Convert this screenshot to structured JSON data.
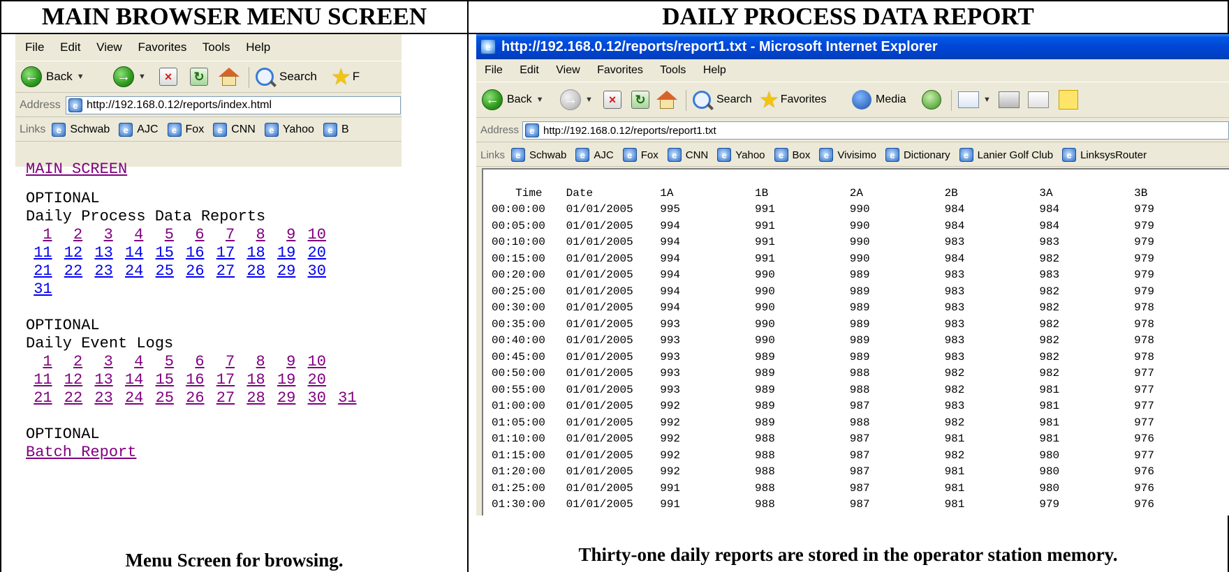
{
  "left_panel": {
    "title": "MAIN BROWSER MENU SCREEN",
    "caption": "Menu Screen for browsing.",
    "browser": {
      "menu": [
        "File",
        "Edit",
        "View",
        "Favorites",
        "Tools",
        "Help"
      ],
      "toolbar": {
        "back": "Back",
        "search": "Search",
        "favorites_partial": "F"
      },
      "address_label": "Address",
      "address": "http://192.168.0.12/reports/index.html",
      "links_label": "Links",
      "links": [
        "Schwab",
        "AJC",
        "Fox",
        "CNN",
        "Yahoo",
        "B"
      ]
    },
    "page": {
      "main_screen_link": "MAIN SCREEN",
      "section1_heading": "OPTIONAL",
      "section1_title": "Daily Process Data Reports",
      "section1_rows": [
        [
          "1",
          "2",
          "3",
          "4",
          "5",
          "6",
          "7",
          "8",
          "9",
          "10"
        ],
        [
          "11",
          "12",
          "13",
          "14",
          "15",
          "16",
          "17",
          "18",
          "19",
          "20"
        ],
        [
          "21",
          "22",
          "23",
          "24",
          "25",
          "26",
          "27",
          "28",
          "29",
          "30"
        ],
        [
          "31"
        ]
      ],
      "section2_heading": "OPTIONAL",
      "section2_title": "Daily Event Logs",
      "section2_rows": [
        [
          "1",
          "2",
          "3",
          "4",
          "5",
          "6",
          "7",
          "8",
          "9",
          "10"
        ],
        [
          "11",
          "12",
          "13",
          "14",
          "15",
          "16",
          "17",
          "18",
          "19",
          "20"
        ],
        [
          "21",
          "22",
          "23",
          "24",
          "25",
          "26",
          "27",
          "28",
          "29",
          "30",
          "31"
        ]
      ],
      "section3_heading": "OPTIONAL",
      "batch_report_link": "Batch Report"
    }
  },
  "right_panel": {
    "title": "DAILY PROCESS DATA REPORT",
    "caption": "Thirty-one daily reports are stored in the operator station memory.",
    "window_title": "http://192.168.0.12/reports/report1.txt - Microsoft Internet Explorer",
    "menu": [
      "File",
      "Edit",
      "View",
      "Favorites",
      "Tools",
      "Help"
    ],
    "toolbar": {
      "back": "Back",
      "search": "Search",
      "favorites": "Favorites",
      "media": "Media"
    },
    "address_label": "Address",
    "address": "http://192.168.0.12/reports/report1.txt",
    "links_label": "Links",
    "links": [
      "Schwab",
      "AJC",
      "Fox",
      "CNN",
      "Yahoo",
      "Box",
      "Vivisimo",
      "Dictionary",
      "Lanier Golf Club",
      "LinksysRouter"
    ],
    "report": {
      "columns": [
        "Time",
        "Date",
        "1A",
        "1B",
        "2A",
        "2B",
        "3A",
        "3B"
      ],
      "rows": [
        [
          "00:00:00",
          "01/01/2005",
          "995",
          "991",
          "990",
          "984",
          "984",
          "979"
        ],
        [
          "00:05:00",
          "01/01/2005",
          "994",
          "991",
          "990",
          "984",
          "984",
          "979"
        ],
        [
          "00:10:00",
          "01/01/2005",
          "994",
          "991",
          "990",
          "983",
          "983",
          "979"
        ],
        [
          "00:15:00",
          "01/01/2005",
          "994",
          "991",
          "990",
          "984",
          "982",
          "979"
        ],
        [
          "00:20:00",
          "01/01/2005",
          "994",
          "990",
          "989",
          "983",
          "983",
          "979"
        ],
        [
          "00:25:00",
          "01/01/2005",
          "994",
          "990",
          "989",
          "983",
          "982",
          "979"
        ],
        [
          "00:30:00",
          "01/01/2005",
          "994",
          "990",
          "989",
          "983",
          "982",
          "978"
        ],
        [
          "00:35:00",
          "01/01/2005",
          "993",
          "990",
          "989",
          "983",
          "982",
          "978"
        ],
        [
          "00:40:00",
          "01/01/2005",
          "993",
          "990",
          "989",
          "983",
          "982",
          "978"
        ],
        [
          "00:45:00",
          "01/01/2005",
          "993",
          "989",
          "989",
          "983",
          "982",
          "978"
        ],
        [
          "00:50:00",
          "01/01/2005",
          "993",
          "989",
          "988",
          "982",
          "982",
          "977"
        ],
        [
          "00:55:00",
          "01/01/2005",
          "993",
          "989",
          "988",
          "982",
          "981",
          "977"
        ],
        [
          "01:00:00",
          "01/01/2005",
          "992",
          "989",
          "987",
          "983",
          "981",
          "977"
        ],
        [
          "01:05:00",
          "01/01/2005",
          "992",
          "989",
          "988",
          "982",
          "981",
          "977"
        ],
        [
          "01:10:00",
          "01/01/2005",
          "992",
          "988",
          "987",
          "981",
          "981",
          "976"
        ],
        [
          "01:15:00",
          "01/01/2005",
          "992",
          "988",
          "987",
          "982",
          "980",
          "977"
        ],
        [
          "01:20:00",
          "01/01/2005",
          "992",
          "988",
          "987",
          "981",
          "980",
          "976"
        ],
        [
          "01:25:00",
          "01/01/2005",
          "991",
          "988",
          "987",
          "981",
          "980",
          "976"
        ],
        [
          "01:30:00",
          "01/01/2005",
          "991",
          "988",
          "987",
          "981",
          "979",
          "976"
        ]
      ]
    }
  }
}
